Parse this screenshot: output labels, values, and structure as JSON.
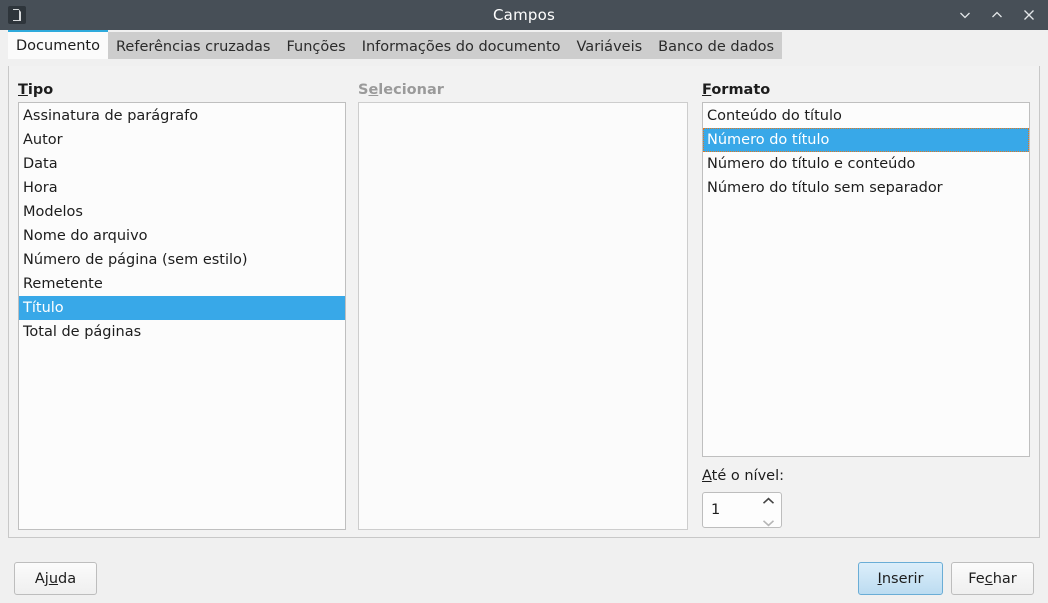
{
  "window": {
    "title": "Campos",
    "app_icon": "document-icon",
    "controls": [
      {
        "name": "minimize-button",
        "icon": "chevron-down-icon"
      },
      {
        "name": "maximize-button",
        "icon": "chevron-up-icon"
      },
      {
        "name": "close-button",
        "icon": "close-icon"
      }
    ]
  },
  "tabs": [
    {
      "label": "Documento",
      "active": true
    },
    {
      "label": "Referências cruzadas",
      "active": false
    },
    {
      "label": "Funções",
      "active": false
    },
    {
      "label": "Informações do documento",
      "active": false
    },
    {
      "label": "Variáveis",
      "active": false
    },
    {
      "label": "Banco de dados",
      "active": false
    }
  ],
  "tipo": {
    "label_prefix": "",
    "label_accel": "T",
    "label_suffix": "ipo",
    "items": [
      "Assinatura de parágrafo",
      "Autor",
      "Data",
      "Hora",
      "Modelos",
      "Nome do arquivo",
      "Número de página (sem estilo)",
      "Remetente",
      "Título",
      "Total de páginas"
    ],
    "selected": "Título",
    "selected_index": 8
  },
  "selecionar": {
    "label_prefix": "S",
    "label_accel": "e",
    "label_suffix": "lecionar",
    "disabled": true,
    "items": [],
    "selected": null
  },
  "formato": {
    "label_prefix": "",
    "label_accel": "F",
    "label_suffix": "ormato",
    "items": [
      "Conteúdo do título",
      "Número do título",
      "Número do título e conteúdo",
      "Número do título sem separador"
    ],
    "selected": "Número do título",
    "selected_index": 1,
    "focused": true
  },
  "level": {
    "label_prefix": "",
    "label_accel": "A",
    "label_suffix": "té o nível:",
    "value": "1",
    "spin_up_icon": "chevron-up-icon",
    "spin_down_icon": "chevron-down-icon"
  },
  "buttons": {
    "help": {
      "prefix": "Aj",
      "accel": "u",
      "suffix": "da"
    },
    "insert": {
      "prefix": "",
      "accel": "I",
      "suffix": "nserir",
      "default": true
    },
    "close": {
      "prefix": "Fe",
      "accel": "c",
      "suffix": "har"
    }
  },
  "colors": {
    "titlebar": "#474f57",
    "accent": "#2eaadc",
    "selection": "#38a8e8",
    "focus_outline": "#e07820",
    "window_bg": "#f0f0f0",
    "panel_bg": "#f2f2f2",
    "list_bg": "#fcfcfc"
  }
}
